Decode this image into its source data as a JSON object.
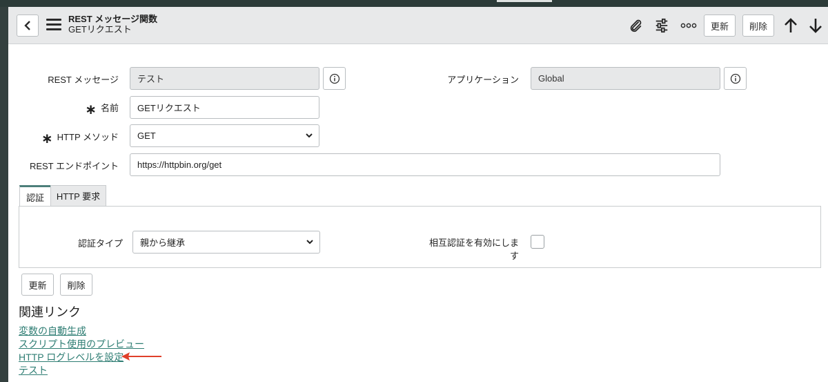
{
  "header": {
    "title_line1": "REST メッセージ関数",
    "title_line2": "GETリクエスト",
    "update_label": "更新",
    "delete_label": "削除"
  },
  "form": {
    "rest_message": {
      "label": "REST メッセージ",
      "value": "テスト"
    },
    "application": {
      "label": "アプリケーション",
      "value": "Global"
    },
    "name": {
      "label": "名前",
      "value": "GETリクエスト"
    },
    "http_method": {
      "label": "HTTP メソッド",
      "value": "GET"
    },
    "endpoint": {
      "label": "REST エンドポイント",
      "value": "https://httpbin.org/get"
    }
  },
  "tabs": [
    {
      "label": "認証"
    },
    {
      "label": "HTTP 要求"
    }
  ],
  "auth": {
    "type_label": "認証タイプ",
    "type_value": "親から継承",
    "mutual_label_line1": "相互認証を有効にしま",
    "mutual_label_line2": "す",
    "mutual_checked": false
  },
  "footer_buttons": {
    "update_label": "更新",
    "delete_label": "削除"
  },
  "related": {
    "title": "関連リンク",
    "links": [
      "変数の自動生成",
      "スクリプト使用のプレビュー",
      "HTTP ログレベルを設定",
      "テスト"
    ]
  },
  "colors": {
    "link": "#2e7d73",
    "arrow": "#e0402a",
    "tab_accent": "#4c7f7a"
  }
}
